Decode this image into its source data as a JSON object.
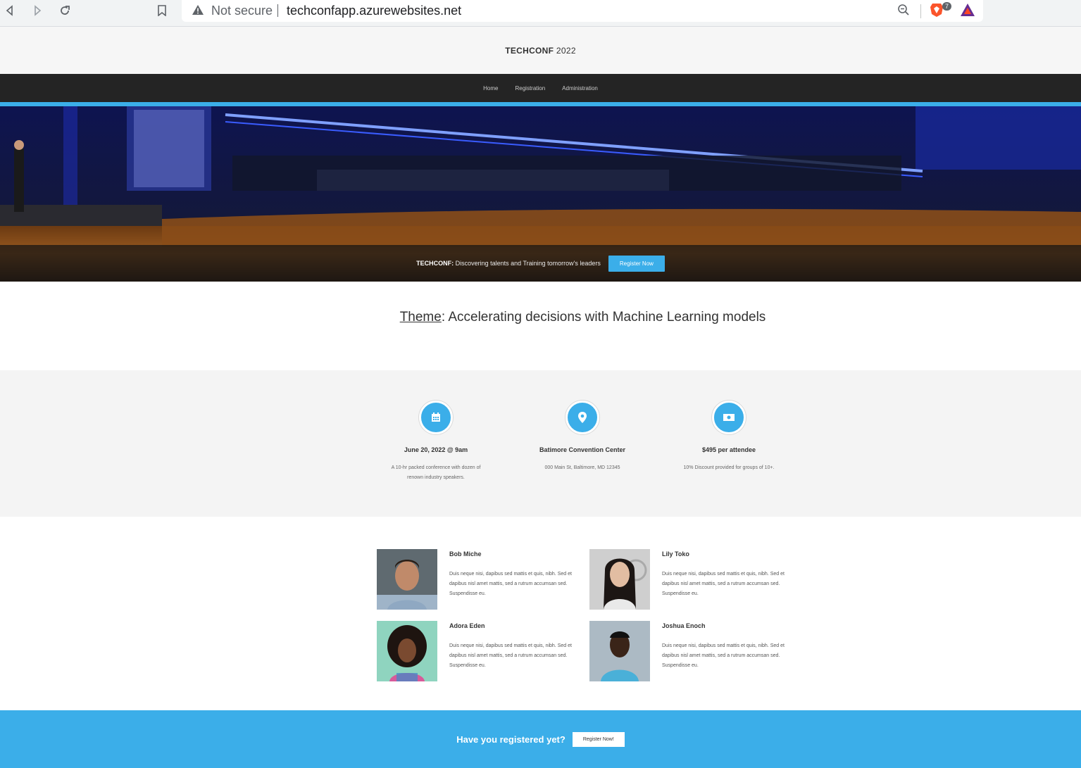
{
  "browser": {
    "security_label": "Not secure",
    "url": "techconfapp.azurewebsites.net",
    "shield_count": "7"
  },
  "header": {
    "brand_bold": "TECHCONF",
    "brand_year": " 2022"
  },
  "nav": {
    "items": [
      {
        "label": "Home"
      },
      {
        "label": "Registration"
      },
      {
        "label": "Administration"
      }
    ]
  },
  "hero": {
    "tagline_bold": "TECHCONF:",
    "tagline_text": " Discovering talents and Training tomorrow's leaders",
    "register_label": "Register Now"
  },
  "theme": {
    "label": "Theme",
    "text": ": Accelerating decisions with Machine Learning models"
  },
  "features": [
    {
      "icon": "calendar-icon",
      "title": "June 20, 2022 @ 9am",
      "desc": "A 10-hr packed conference with dozen of renown industry speakers."
    },
    {
      "icon": "map-pin-icon",
      "title": "Batimore Convention Center",
      "desc": "000 Main St, Baltimore, MD 12345"
    },
    {
      "icon": "money-icon",
      "title": "$495 per attendee",
      "desc": "10% Discount provided for groups of 10+."
    }
  ],
  "speakers": [
    {
      "name": "Bob Miche",
      "bio": "Duis neque nisi, dapibus sed mattis et quis, nibh. Sed et dapibus nisl amet mattis, sed a rutrum accumsan sed. Suspendisse eu."
    },
    {
      "name": "Lily Toko",
      "bio": "Duis neque nisi, dapibus sed mattis et quis, nibh. Sed et dapibus nisl amet mattis, sed a rutrum accumsan sed. Suspendisse eu."
    },
    {
      "name": "Adora Eden",
      "bio": "Duis neque nisi, dapibus sed mattis et quis, nibh. Sed et dapibus nisl amet mattis, sed a rutrum accumsan sed. Suspendisse eu."
    },
    {
      "name": "Joshua Enoch",
      "bio": "Duis neque nisi, dapibus sed mattis et quis, nibh. Sed et dapibus nisl amet mattis, sed a rutrum accumsan sed. Suspendisse eu."
    }
  ],
  "cta": {
    "question": "Have you registered yet?",
    "button_label": "Register Now!"
  },
  "colors": {
    "accent": "#3baee9",
    "navbar": "#242424"
  }
}
